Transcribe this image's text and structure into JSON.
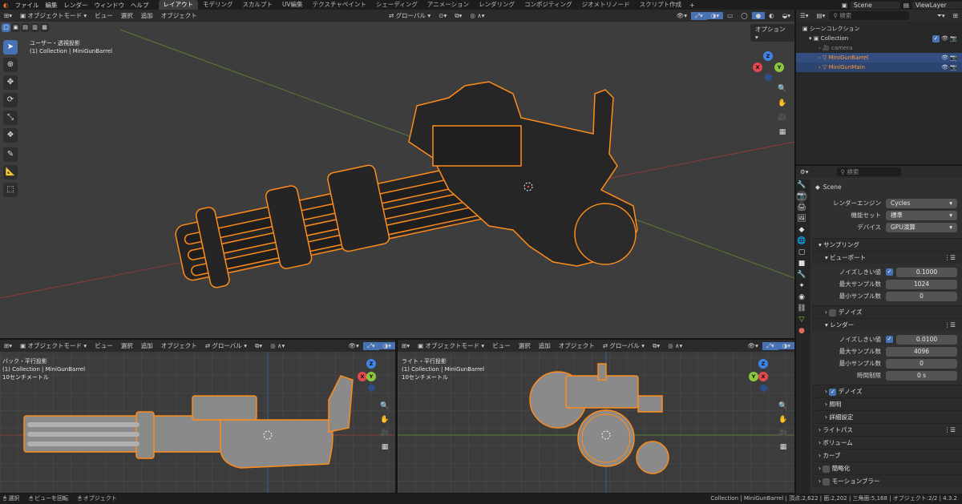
{
  "topbar": {
    "menus": [
      "ファイル",
      "編集",
      "レンダー",
      "ウィンドウ",
      "ヘルプ"
    ],
    "workspaces": [
      "レイアウト",
      "モデリング",
      "スカルプト",
      "UV編集",
      "テクスチャペイント",
      "シェーディング",
      "アニメーション",
      "レンダリング",
      "コンポジティング",
      "ジオメトリノード",
      "スクリプト作成"
    ],
    "active_workspace": "レイアウト",
    "scene": "Scene",
    "view_layer": "ViewLayer"
  },
  "viewport_main": {
    "mode": "オブジェクトモード",
    "menus": [
      "ビュー",
      "選択",
      "追加",
      "オブジェクト"
    ],
    "transform": "グローバル",
    "options": "オプション",
    "view_name": "ユーザー・透視投影",
    "collection_info": "(1) Collection | MiniGunBarrel"
  },
  "viewport_left": {
    "mode": "オブジェクトモード",
    "menus": [
      "ビュー",
      "選択",
      "追加",
      "オブジェクト"
    ],
    "transform": "グローバル",
    "view_name": "バック・平行投影",
    "collection_info": "(1) Collection | MiniGunBarrel",
    "scale": "10センチメートル"
  },
  "viewport_right": {
    "mode": "オブジェクトモード",
    "menus": [
      "ビュー",
      "選択",
      "追加",
      "オブジェクト"
    ],
    "transform": "グローバル",
    "view_name": "ライト・平行投影",
    "collection_info": "(1) Collection | MiniGunBarrel",
    "scale": "10センチメートル"
  },
  "gizmo": {
    "x": "X",
    "y": "Y",
    "z": "Z"
  },
  "outliner": {
    "search_placeholder": "検索",
    "root": "シーンコレクション",
    "collection": "Collection",
    "items": [
      {
        "name": "camera",
        "selected": false
      },
      {
        "name": "MiniGunBarrel",
        "selected": true
      },
      {
        "name": "MiniGunMain",
        "selected": true
      }
    ]
  },
  "properties": {
    "search_placeholder": "検索",
    "context": "Scene",
    "render_engine_label": "レンダーエンジン",
    "render_engine": "Cycles",
    "feature_set_label": "機能セット",
    "feature_set": "標準",
    "device_label": "デバイス",
    "device": "GPU演算",
    "sampling": "サンプリング",
    "viewport": "ビューポート",
    "noise_threshold_label": "ノイズしきい値",
    "viewport_noise_threshold": "0.1000",
    "max_samples_label": "最大サンプル数",
    "viewport_max_samples": "1024",
    "min_samples_label": "最小サンプル数",
    "viewport_min_samples": "0",
    "denoise": "デノイズ",
    "render": "レンダー",
    "render_noise_threshold": "0.0100",
    "render_max_samples": "4096",
    "render_min_samples": "0",
    "time_limit_label": "時間制限",
    "time_limit": "0 s",
    "lights": "照明",
    "advanced": "詳細設定",
    "sections": [
      "ライトパス",
      "ボリューム",
      "カーブ",
      "簡略化",
      "モーションブラー"
    ]
  },
  "status": {
    "select": "選択",
    "rotate": "ビューを回転",
    "object": "オブジェクト",
    "stats": "Collection | MiniGunBarrel | 頂点:2,622 | 面:2,202 | 三角面:5,168 | オブジェクト:2/2 | 4.3.2"
  },
  "colors": {
    "accent": "#4772b3",
    "selection": "#ff8c1a",
    "x_axis": "#e2484d",
    "y_axis": "#8bc63f",
    "z_axis": "#3f84e5"
  }
}
